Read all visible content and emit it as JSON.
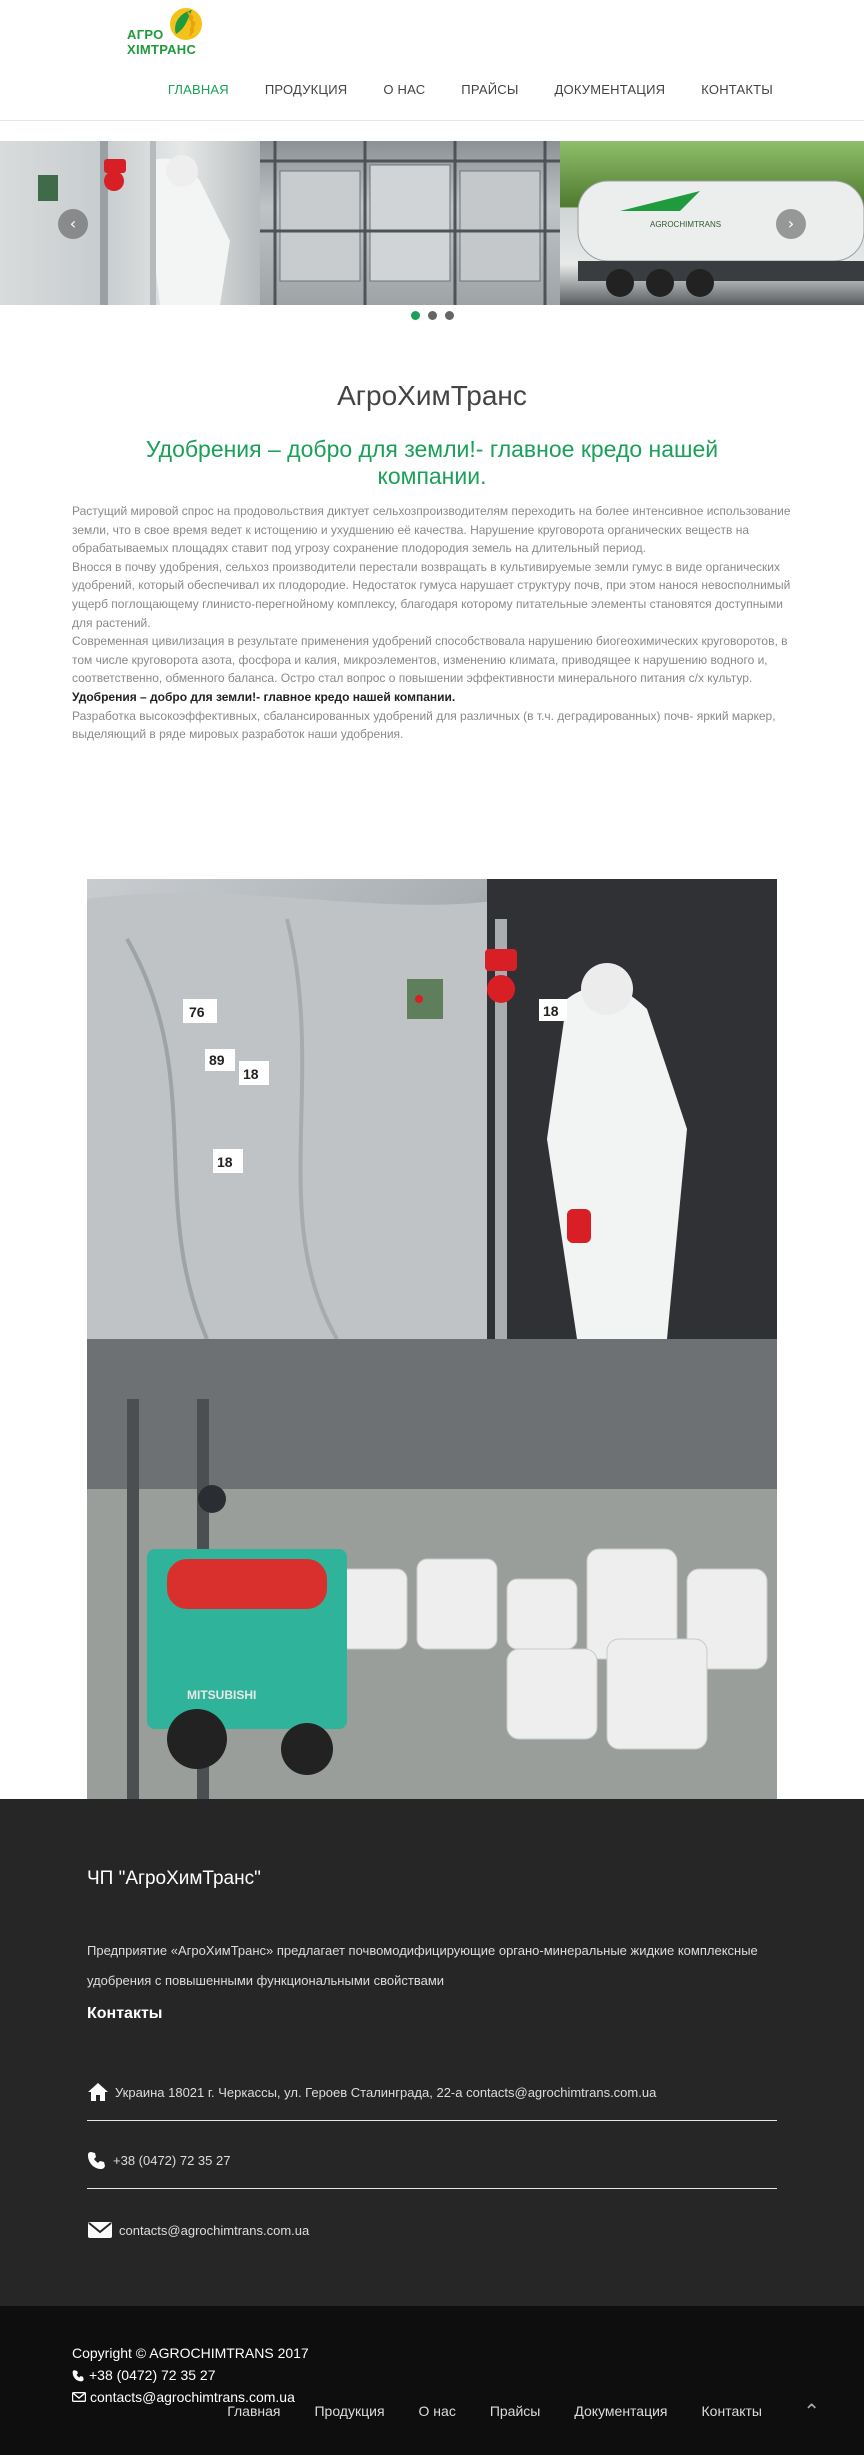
{
  "header": {
    "logo_line1": "АГРО",
    "logo_line2": "ХІМТРАНС",
    "nav": [
      {
        "label": "Главная",
        "active": true
      },
      {
        "label": "Продукция"
      },
      {
        "label": "О нас"
      },
      {
        "label": "Прайсы"
      },
      {
        "label": "Документация"
      },
      {
        "label": "Контакты"
      }
    ]
  },
  "slider": {
    "prev_icon": "chevron-left-icon",
    "next_icon": "chevron-right-icon",
    "dots": 3,
    "active_dot": 0,
    "tanker_text": "AGROCHIMTRANS"
  },
  "intro": {
    "title": "АгроХимТранс",
    "slogan": "Удобрения – добро для земли!- главное кредо нашей компании.",
    "paragraphs": [
      "Растущий мировой спрос на продовольствия диктует сельхозпроизводителям переходить на более интенсивное использование земли, что в свое время ведет к истощению и ухудшению её качества. Нарушение круговорота органических веществ на обрабатываемых площадях ставит под угрозу сохранение плодородия земель на длительный период.",
      "Вносся в почву удобрения, сельхоз производители перестали возвращать в культивируемые земли гумус в виде органических удобрений, который обеспечивал их плодородие. Недостаток гумуса нарушает структуру почв, при этом нанося невосполнимый ущерб поглощающему глинисто-перегнойному комплексу, благодаря которому питательные элементы становятся доступными для растений.",
      "Современная цивилизация в результате применения удобрений способствовала нарушению биогеохимических круговоротов, в том числе круговорота азота, фосфора и калия, микроэлементов, изменению климата, приводящее к нарушению водного и, соответственно, обменного баланса. Остро стал вопрос о повышении эффективности минерального питания с/х культур."
    ],
    "bold_line": "Удобрения – добро для земли!- главное кредо нашей компании.",
    "closing": "Разработка высокоэффективных, сбалансированных удобрений для различных (в т.ч. деградированных) почв- яркий маркер, выделяющий в ряде мировых разработок наши удобрения."
  },
  "photos": {
    "photo1_labels": [
      "76",
      "18",
      "89",
      "18",
      "18"
    ],
    "forklift_brand": "MITSUBISHI"
  },
  "footer": {
    "company_name": "ЧП \"АгроХимТранс\"",
    "description": "Предприятие «АгроХимТранс» предлагает почвомодифицирующие органо-минеральные жидкие комплексные удобрения с повышенными функциональными свойствами",
    "contacts_title": "Контакты",
    "address": "Украина 18021 г. Черкассы, ул. Героев Сталинграда, 22-а contacts@agrochimtrans.com.ua",
    "phone": "+38 (0472) 72 35 27",
    "email": "contacts@agrochimtrans.com.ua"
  },
  "bottom": {
    "copyright": "Copyright © AGROCHIMTRANS 2017",
    "phone": "+38 (0472) 72 35 27",
    "email": "contacts@agrochimtrans.com.ua",
    "nav": [
      "Главная",
      "Продукция",
      "О нас",
      "Прайсы",
      "Документация",
      "Контакты"
    ],
    "to_top_icon": "chevron-up-icon"
  },
  "colors": {
    "accent": "#1aa058",
    "footer_bg": "#262626",
    "bottom_bg": "#0e0e0e"
  }
}
